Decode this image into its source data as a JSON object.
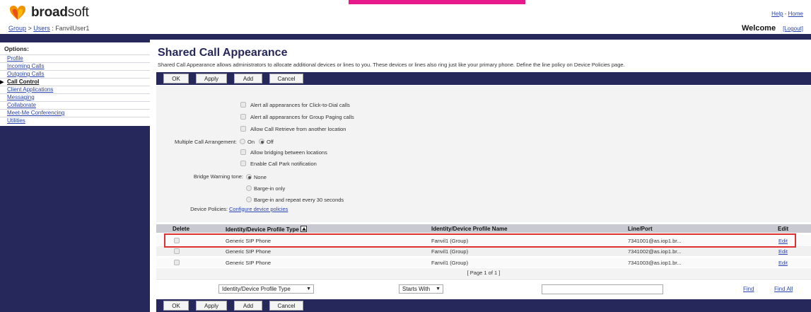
{
  "header": {
    "logo_text_bold": "broad",
    "logo_text_rest": "soft",
    "breadcrumb": {
      "group": "Group",
      "sep1": " > ",
      "users": "Users",
      "sep2": " : ",
      "user": "FanvilUser1"
    },
    "help": "Help",
    "help_sep": " - ",
    "home": "Home",
    "welcome": "Welcome",
    "logout": "[Logout]"
  },
  "sidebar": {
    "title": "Options:",
    "items": [
      {
        "label": "Profile"
      },
      {
        "label": "Incoming Calls"
      },
      {
        "label": "Outgoing Calls"
      },
      {
        "label": "Call Control"
      },
      {
        "label": "Client Applications"
      },
      {
        "label": "Messaging"
      },
      {
        "label": "Collaborate"
      },
      {
        "label": "Meet-Me Conferencing"
      },
      {
        "label": "Utilities"
      }
    ],
    "active_marker": "▶"
  },
  "page": {
    "title": "Shared Call Appearance",
    "description": "Shared Call Appearance allows administrators to allocate additional devices or lines to you. These devices or lines also ring just like your primary phone. Define the line policy on Device Policies page."
  },
  "buttons": {
    "ok": "OK",
    "apply": "Apply",
    "add": "Add",
    "cancel": "Cancel"
  },
  "settings": {
    "alert_click_to_dial": "Alert all appearances for Click-to-Dial calls",
    "alert_group_paging": "Alert all appearances for Group Paging calls",
    "allow_call_retrieve": "Allow Call Retrieve from another location",
    "mca_label": "Multiple Call Arrangement:",
    "mca_on": "On",
    "mca_off": "Off",
    "allow_bridging": "Allow bridging between locations",
    "enable_call_park": "Enable Call Park notification",
    "bridge_label": "Bridge Warning tone:",
    "bridge_none": "None",
    "bridge_barge_in": "Barge-in only",
    "bridge_barge_repeat": "Barge-in and repeat every 30 seconds",
    "device_policies_label": "Device Policies:",
    "device_policies_link": "Configure device policies"
  },
  "table": {
    "columns": [
      "Delete",
      "Identity/Device Profile Type",
      "Identity/Device Profile Name",
      "Line/Port",
      "Edit"
    ],
    "rows": [
      {
        "type": "Generic SIP Phone",
        "name": "Fanvil1 (Group)",
        "line": "7341001@as.iop1.br...",
        "edit": "Edit"
      },
      {
        "type": "Generic SIP Phone",
        "name": "Fanvil1 (Group)",
        "line": "7341002@as.iop1.br...",
        "edit": "Edit"
      },
      {
        "type": "Generic SIP Phone",
        "name": "Fanvil1 (Group)",
        "line": "7341003@as.iop1.br...",
        "edit": "Edit"
      }
    ],
    "pager": "[ Page 1 of 1 ]"
  },
  "search": {
    "field_select": "Identity/Device Profile Type",
    "mode_select": "Starts With",
    "find": "Find",
    "find_all": "Find All"
  },
  "colors": {
    "navy": "#26275b",
    "link": "#2b45b4",
    "highlight": "#e03131",
    "brand_pink": "#e8198b"
  }
}
